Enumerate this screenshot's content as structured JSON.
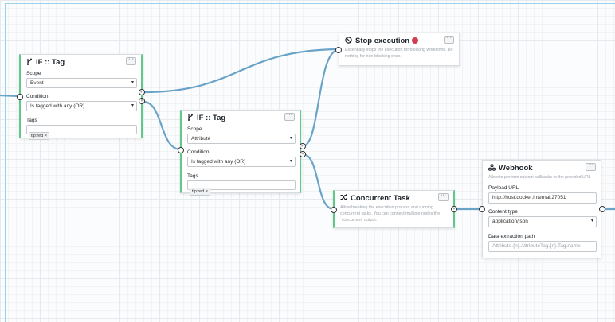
{
  "colors": {
    "wire": "#6aa3c8",
    "accent_green": "#5fc98a",
    "stop_red": "#d33b4e"
  },
  "if_node_1": {
    "icon": "branch-icon",
    "title": "IF :: Tag",
    "scope_label": "Scope",
    "scope_value": "Event",
    "condition_label": "Condition",
    "condition_value": "Is tagged with any (OR)",
    "tags_label": "Tags",
    "tags": [
      "tlp:red"
    ]
  },
  "if_node_2": {
    "icon": "branch-icon",
    "title": "IF :: Tag",
    "scope_label": "Scope",
    "scope_value": "Attribute",
    "condition_label": "Condition",
    "condition_value": "Is tagged with any (OR)",
    "tags_label": "Tags",
    "tags": [
      "tlp:red"
    ]
  },
  "stop_node": {
    "icon": "no-entry-icon",
    "title": "Stop execution",
    "description": "Essentially stops the execution for blocking workflows. Do nothing for non-blocking ones"
  },
  "concurrent_node": {
    "icon": "shuffle-icon",
    "title": "Concurrent Task",
    "description": "Allow breaking the execution process and running concurrent tasks. You can connect multiple nodes the `concurrent` output."
  },
  "webhook_node": {
    "icon": "webhook-icon",
    "title": "Webhook",
    "description": "Allow to perform custom callbacks to the provided URL",
    "payload_label": "Payload URL",
    "payload_value": "http://host.docker.internal:27051",
    "content_type_label": "Content type",
    "content_type_value": "application/json",
    "extraction_label": "Data extraction path",
    "extraction_placeholder": "Attribute.{n}.AttributeTag.{n}.Tag.name"
  }
}
